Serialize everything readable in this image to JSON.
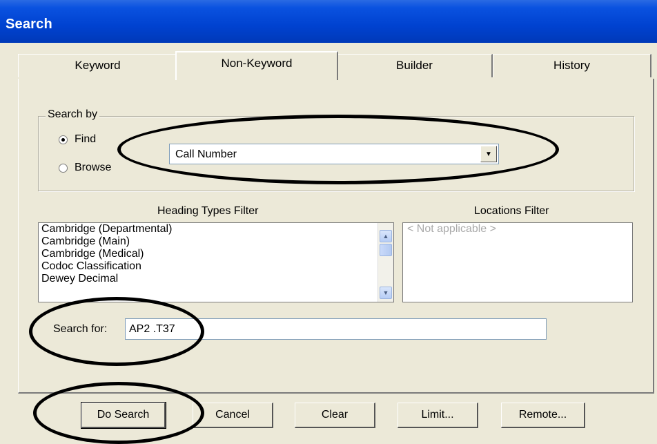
{
  "window": {
    "title": "Search"
  },
  "tabs": [
    {
      "label": "Keyword"
    },
    {
      "label": "Non-Keyword"
    },
    {
      "label": "Builder"
    },
    {
      "label": "History"
    }
  ],
  "search_by": {
    "legend": "Search by",
    "options": [
      {
        "label": "Find",
        "selected": true
      },
      {
        "label": "Browse",
        "selected": false
      }
    ],
    "combo_value": "Call Number"
  },
  "heading_filter": {
    "title": "Heading Types Filter",
    "items": [
      "Cambridge (Departmental)",
      "Cambridge (Main)",
      "Cambridge (Medical)",
      "Codoc Classification",
      "Dewey Decimal"
    ]
  },
  "locations_filter": {
    "title": "Locations Filter",
    "placeholder": "< Not applicable >"
  },
  "search_for": {
    "label": "Search for:",
    "value": "AP2 .T37"
  },
  "buttons": {
    "do_search": "Do Search",
    "cancel": "Cancel",
    "clear": "Clear",
    "limit": "Limit...",
    "remote": "Remote..."
  },
  "colors": {
    "titlebar": "#0042d0",
    "dialog": "#ece9d8",
    "annotation": "#000000"
  }
}
